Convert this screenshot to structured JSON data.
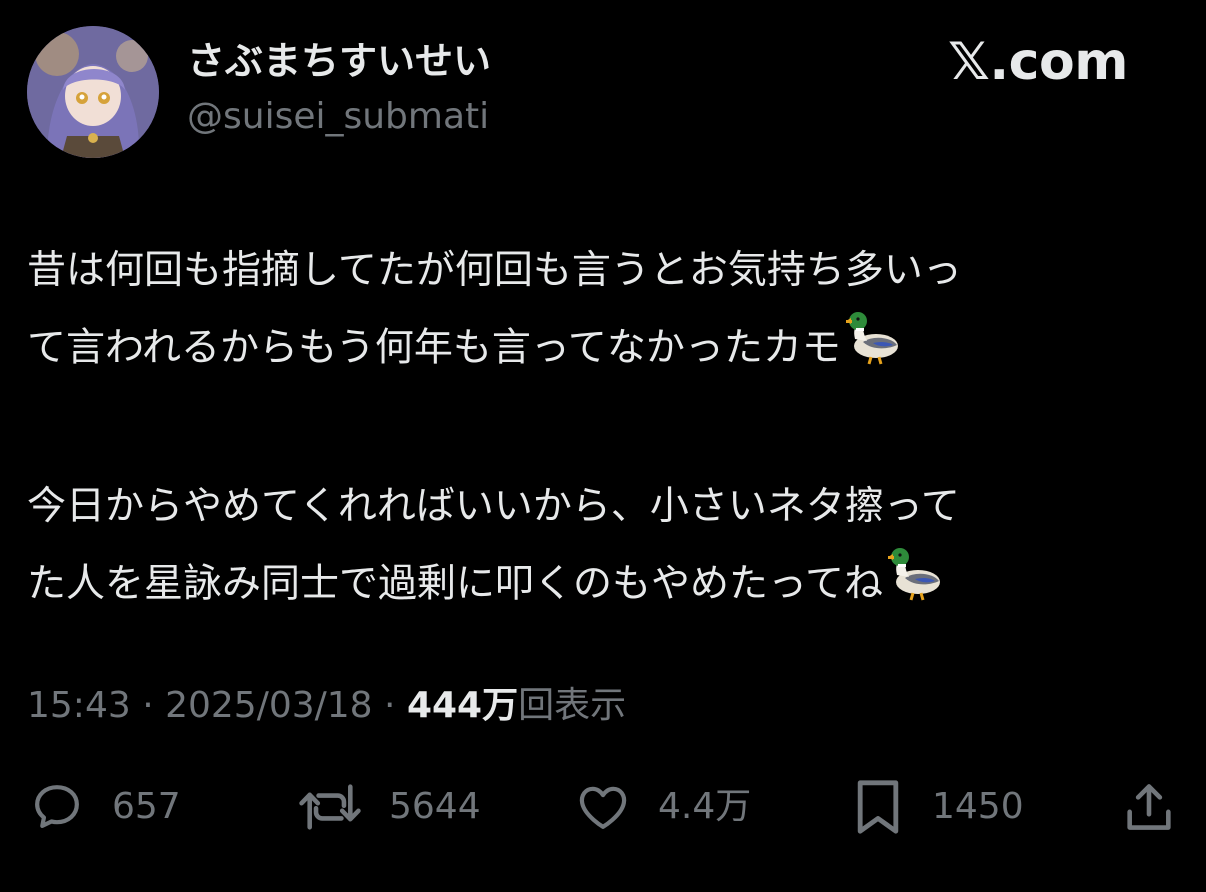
{
  "author": {
    "display_name": "さぶまちすいせい",
    "handle": "@suisei_submati",
    "avatar_icon": "avatar-image"
  },
  "brand": {
    "label": "𝕏.com"
  },
  "tweet": {
    "lines": [
      "昔は何回も指摘してたが何回も言うとお気持ち多いっ",
      "て言われるからもう何年も言ってなかったカモ",
      "今日からやめてくれればいいから、小さいネタ擦って",
      "た人を星詠み同士で過剰に叩くのもやめたってね"
    ],
    "emoji": "duck"
  },
  "meta": {
    "time": "15:43",
    "sep1": " · ",
    "date": "2025/03/18",
    "sep2": " · ",
    "views_count": "444万",
    "views_label": "回表示"
  },
  "actions": {
    "reply": {
      "icon": "reply-icon",
      "count": "657"
    },
    "retweet": {
      "icon": "retweet-icon",
      "count": "5644"
    },
    "like": {
      "icon": "heart-icon",
      "count": "4.4万"
    },
    "bookmark": {
      "icon": "bookmark-icon",
      "count": "1450"
    },
    "share": {
      "icon": "share-icon"
    }
  },
  "colors": {
    "background": "#000000",
    "primary_text": "#e7e9ea",
    "secondary_text": "#71767b"
  }
}
